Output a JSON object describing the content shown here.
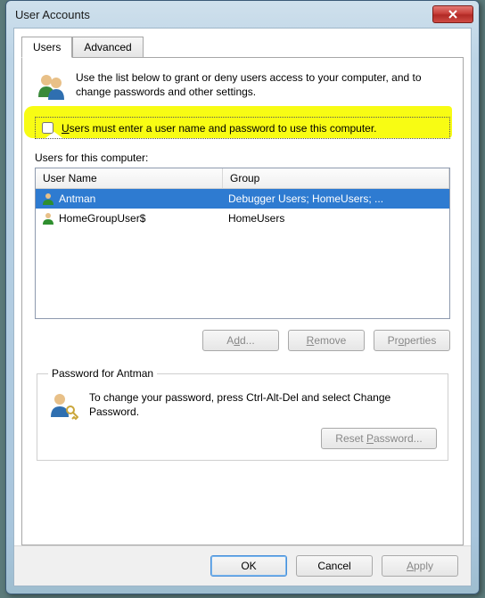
{
  "window": {
    "title": "User Accounts"
  },
  "tabs": {
    "users": "Users",
    "advanced": "Advanced"
  },
  "intro": "Use the list below to grant or deny users access to your computer, and to change passwords and other settings.",
  "checkbox": {
    "checked": false,
    "label_pre": "U",
    "label_rest": "sers must enter a user name and password to use this computer."
  },
  "list": {
    "caption": "Users for this computer:",
    "headers": {
      "user": "User Name",
      "group": "Group"
    },
    "rows": [
      {
        "user": "Antman",
        "group": "Debugger Users; HomeUsers; ...",
        "selected": true
      },
      {
        "user": "HomeGroupUser$",
        "group": "HomeUsers",
        "selected": false
      }
    ]
  },
  "buttons": {
    "add_pre": "A",
    "add_accel": "d",
    "add_post": "d...",
    "remove_accel": "R",
    "remove_post": "emove",
    "props_pre": "Pr",
    "props_accel": "o",
    "props_post": "perties",
    "reset_pre": "Reset ",
    "reset_accel": "P",
    "reset_post": "assword...",
    "ok": "OK",
    "cancel": "Cancel",
    "apply_accel": "A",
    "apply_post": "pply"
  },
  "password_group": {
    "legend": "Password for Antman",
    "text": "To change your password, press Ctrl-Alt-Del and select Change Password."
  }
}
